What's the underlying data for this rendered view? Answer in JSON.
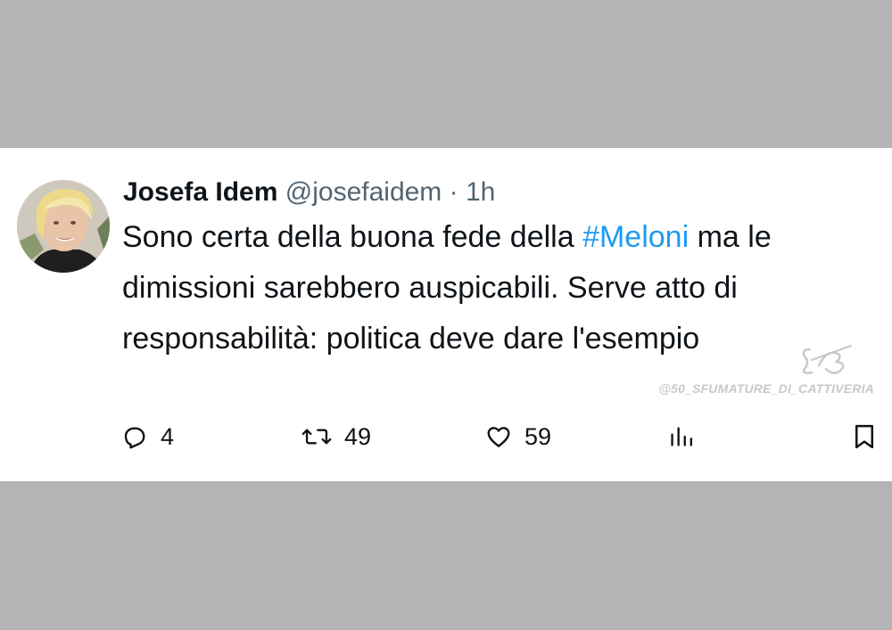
{
  "tweet": {
    "author_name": "Josefa Idem",
    "handle": "@josefaidem",
    "separator": "·",
    "time": "1h",
    "text_before": "Sono certa della buona fede della ",
    "hashtag": "#Meloni",
    "text_after": " ma le dimissioni sarebbero auspicabili. Serve atto di responsabilità: politica deve dare l'esempio"
  },
  "actions": {
    "reply_icon": "reply-icon",
    "reply_count": "4",
    "retweet_icon": "retweet-icon",
    "retweet_count": "49",
    "like_icon": "heart-icon",
    "like_count": "59",
    "views_icon": "views-icon",
    "bookmark_icon": "bookmark-icon"
  },
  "watermark": {
    "text": "@50_SFUMATURE_DI_CATTIVERIA"
  },
  "colors": {
    "background": "#b4b3b5",
    "card": "#ffffff",
    "text": "#0f1419",
    "secondary": "#536471",
    "hashtag": "#1d9bf0"
  }
}
